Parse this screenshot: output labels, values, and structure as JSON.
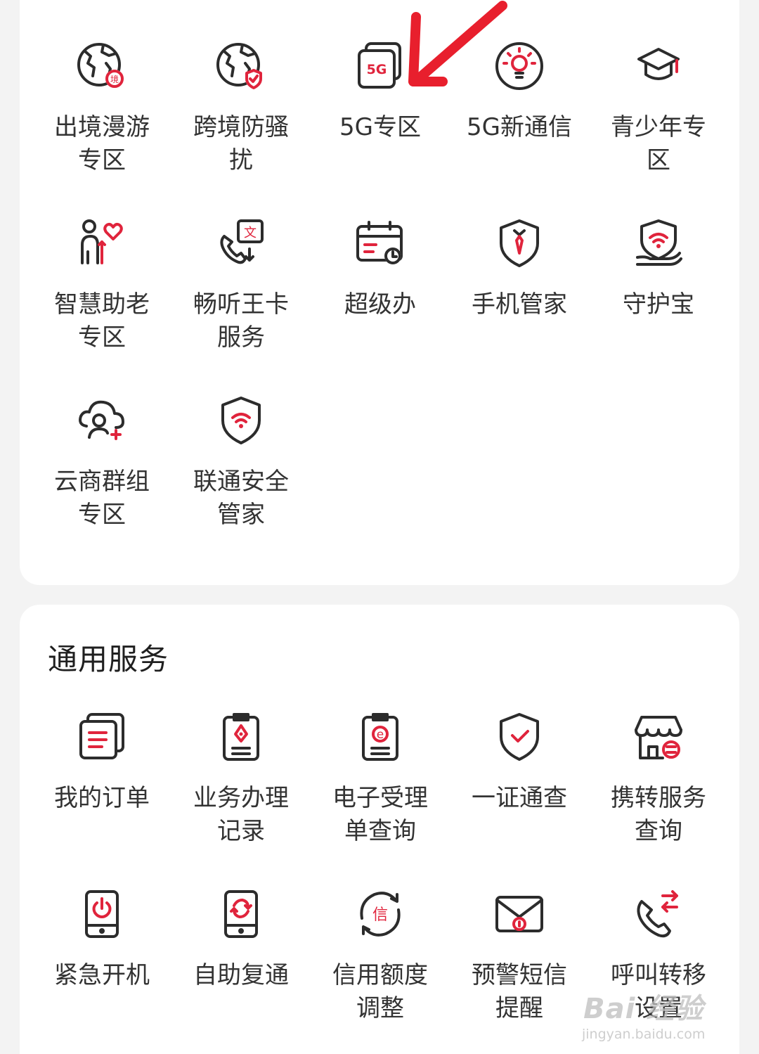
{
  "special_services": {
    "items": [
      {
        "label": "出境漫游专区",
        "icon": "globe-border-icon"
      },
      {
        "label": "跨境防骚扰",
        "icon": "globe-shield-icon"
      },
      {
        "label": "5G专区",
        "icon": "5g-card-icon",
        "icon_text": "5G"
      },
      {
        "label": "5G新通信",
        "icon": "lightbulb-icon"
      },
      {
        "label": "青少年专区",
        "icon": "graduation-cap-icon"
      },
      {
        "label": "智慧助老专区",
        "icon": "elder-heart-icon"
      },
      {
        "label": "畅听王卡服务",
        "icon": "phone-translate-icon",
        "icon_text": "文"
      },
      {
        "label": "超级办",
        "icon": "calendar-clock-icon"
      },
      {
        "label": "手机管家",
        "icon": "shield-tie-icon"
      },
      {
        "label": "守护宝",
        "icon": "shield-wifi-hand-icon"
      },
      {
        "label": "云商群组专区",
        "icon": "cloud-user-icon"
      },
      {
        "label": "联通安全管家",
        "icon": "shield-wifi-icon"
      }
    ]
  },
  "general_services": {
    "title": "通用服务",
    "items": [
      {
        "label": "我的订单",
        "icon": "order-list-icon"
      },
      {
        "label": "业务办理记录",
        "icon": "clipboard-pen-icon"
      },
      {
        "label": "电子受理单查询",
        "icon": "clipboard-e-icon",
        "icon_text": "e"
      },
      {
        "label": "一证通查",
        "icon": "shield-check-icon"
      },
      {
        "label": "携转服务查询",
        "icon": "store-transfer-icon"
      },
      {
        "label": "紧急开机",
        "icon": "phone-power-icon"
      },
      {
        "label": "自助复通",
        "icon": "phone-refresh-icon"
      },
      {
        "label": "信用额度调整",
        "icon": "credit-cycle-icon",
        "icon_text": "信"
      },
      {
        "label": "预警短信提醒",
        "icon": "envelope-alert-icon"
      },
      {
        "label": "呼叫转移设置",
        "icon": "call-forward-icon"
      }
    ]
  },
  "watermark": {
    "line1": "Bai 经验",
    "line2": "jingyan.baidu.com"
  },
  "colors": {
    "accent": "#e0243c",
    "icon_stroke": "#2c2c2c",
    "background": "#f3f3f3",
    "card": "#ffffff"
  }
}
